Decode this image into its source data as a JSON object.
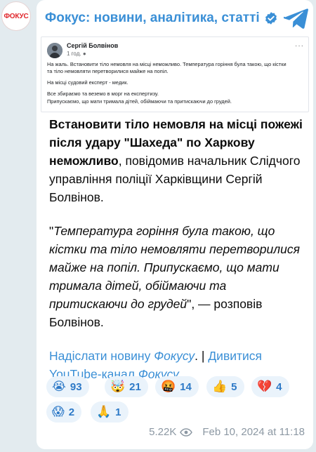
{
  "channel_avatar": {
    "text": "ФОКУС"
  },
  "header": {
    "title": "Фокус: новини, аналітика, статті",
    "verified_icon": "verified-badge-icon",
    "telegram_icon": "telegram-logo-icon"
  },
  "embedded_post": {
    "author": "Сергій Болвінов",
    "time": "1 год.",
    "more": "···",
    "lines": [
      "На жаль. Встановити тіло немовля на місці неможливо. Температура горіння була такою, що кістки",
      "та тіло немовляти перетворилися майже на попіл.",
      "На місці судовий експерт - медик.",
      "Все збираємо та веземо в морг на експертизу.",
      "Припускаємо, що мати тримала дітей, обіймаючи та притискаючи до грудей."
    ]
  },
  "message": {
    "lead_bold": "Встановити тіло немовля на місці пожежі після удару \"Шахеда\" по Харкову неможливо",
    "lead_rest": ", повідомив начальник Слідчого управління поліції Харківщини Сергій Болвінов.",
    "quote_open": "\"",
    "quote_italic": "Температура горіння була такою, що кістки та тіло немовляти перетворилися майже на попіл. Припускаємо, що мати тримала дітей, обіймаючи та притискаючи до грудей",
    "quote_close": "\", — розповів Болвінов.",
    "link1_text": "Надіслати новину ",
    "link1_italic": "Фокусу",
    "link1_end": ".",
    "separator": " | ",
    "link2_text": "Дивитися YouTube-канал ",
    "link2_italic": "Фокусу",
    "link2_end": "."
  },
  "reactions": [
    {
      "emoji": "😭",
      "count": "93"
    },
    {
      "emoji": "🤯",
      "count": "21"
    },
    {
      "emoji": "🤬",
      "count": "14"
    },
    {
      "emoji": "👍",
      "count": "5"
    },
    {
      "emoji": "💔",
      "count": "4"
    },
    {
      "emoji": "😱",
      "count": "2"
    },
    {
      "emoji": "🙏",
      "count": "1"
    }
  ],
  "meta": {
    "views": "5.22K",
    "date": "Feb 10, 2024 at 11:18",
    "eye_icon": "views-eye-icon"
  },
  "colors": {
    "accent": "#3a8fd6",
    "background": "#e3ebef",
    "brand_red": "#e0262b"
  }
}
